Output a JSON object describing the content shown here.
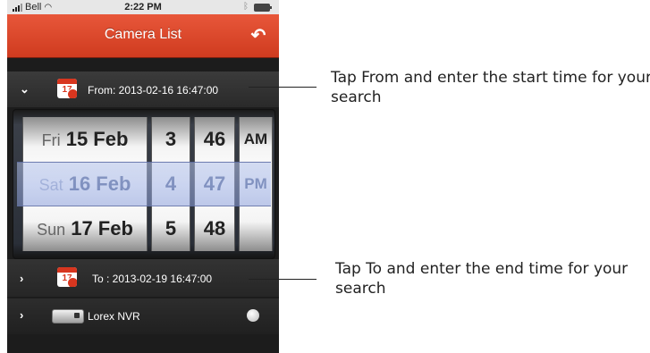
{
  "status_bar": {
    "carrier": "Bell",
    "time": "2:22 PM"
  },
  "nav": {
    "title": "Camera List",
    "back_icon": "undo-arrow-icon"
  },
  "rows": {
    "from": {
      "label": "From: 2013-02-16 16:47:00",
      "expanded": true
    },
    "to": {
      "label": "To : 2013-02-19 16:47:00",
      "expanded": false
    },
    "nvr": {
      "label": "Lorex NVR"
    }
  },
  "calendar_icon_day": "17",
  "picker": {
    "date_wheel": [
      {
        "dow": "Fri",
        "date": "15 Feb"
      },
      {
        "dow": "Sat",
        "date": "16 Feb"
      },
      {
        "dow": "Sun",
        "date": "17 Feb"
      }
    ],
    "hour_wheel": [
      "3",
      "4",
      "5"
    ],
    "minute_wheel": [
      "46",
      "47",
      "48"
    ],
    "ampm_wheel": [
      "AM",
      "PM",
      ""
    ]
  },
  "callouts": {
    "from": "Tap From and enter the start time for your search",
    "to": "Tap To and enter the end time for your search"
  },
  "colors": {
    "nav_red": "#d8361f",
    "selection_blue": "#5a6b95"
  }
}
